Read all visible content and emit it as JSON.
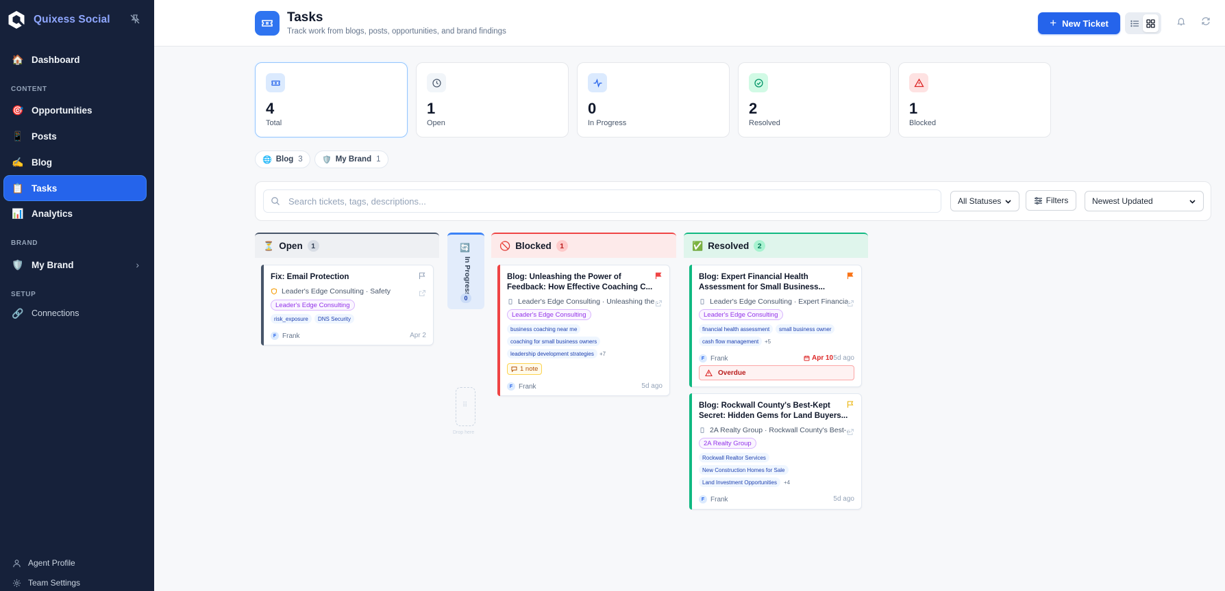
{
  "app": {
    "name": "Quixess Social"
  },
  "sidebar": {
    "dashboard": "Dashboard",
    "section_content": "CONTENT",
    "opportunities": "Opportunities",
    "posts": "Posts",
    "blog": "Blog",
    "tasks": "Tasks",
    "analytics": "Analytics",
    "section_brand": "BRAND",
    "my_brand": "My Brand",
    "section_setup": "SETUP",
    "connections": "Connections",
    "agent_profile": "Agent Profile",
    "team_settings": "Team Settings"
  },
  "header": {
    "title": "Tasks",
    "subtitle": "Track work from blogs, posts, opportunities, and brand findings",
    "new_ticket": "New Ticket"
  },
  "stats": [
    {
      "value": "4",
      "label": "Total"
    },
    {
      "value": "1",
      "label": "Open"
    },
    {
      "value": "0",
      "label": "In Progress"
    },
    {
      "value": "2",
      "label": "Resolved"
    },
    {
      "value": "1",
      "label": "Blocked"
    }
  ],
  "sources": [
    {
      "emoji": "🌐",
      "label": "Blog",
      "count": "3"
    },
    {
      "emoji": "🛡️",
      "label": "My Brand",
      "count": "1"
    }
  ],
  "toolbar": {
    "search_placeholder": "Search tickets, tags, descriptions...",
    "status_select": "All Statuses",
    "filters_label": "Filters",
    "sort_select": "Newest Updated"
  },
  "columns": {
    "open": {
      "emoji": "⏳",
      "label": "Open",
      "count": "1"
    },
    "in_progress": {
      "emoji": "🔄",
      "label": "In Progress",
      "count": "0"
    },
    "blocked": {
      "emoji": "🚫",
      "label": "Blocked",
      "count": "1"
    },
    "resolved": {
      "emoji": "✅",
      "label": "Resolved",
      "count": "2"
    }
  },
  "dropzone": {
    "label": "Drop here"
  },
  "cards": {
    "email": {
      "title": "Fix: Email Protection",
      "meta": "Leader's Edge Consulting · Safety",
      "org": "Leader's Edge Consulting",
      "tags": [
        "risk_exposure",
        "DNS Security"
      ],
      "assignee_initial": "F",
      "assignee": "Frank",
      "date": "Apr 2"
    },
    "feedback": {
      "title_line1": "Blog: Unleashing the Power of",
      "title_line2": "Feedback: How Effective Coaching C...",
      "meta": "Leader's Edge Consulting · Unleashing the ...",
      "org": "Leader's Edge Consulting",
      "tags": [
        "business coaching near me",
        "coaching for small business owners",
        "leadership development strategies"
      ],
      "more": "+7",
      "note": "1 note",
      "assignee_initial": "F",
      "assignee": "Frank",
      "date": "5d ago"
    },
    "financial": {
      "title_line1": "Blog: Expert Financial Health",
      "title_line2": "Assessment for Small Business...",
      "meta": "Leader's Edge Consulting · Expert Financia...",
      "org": "Leader's Edge Consulting",
      "tags": [
        "financial health assessment",
        "small business owner",
        "cash flow management"
      ],
      "more": "+5",
      "assignee_initial": "F",
      "assignee": "Frank",
      "due": "Apr 10",
      "date": "5d ago",
      "overdue": "Overdue"
    },
    "rockwall": {
      "title_line1": "Blog: Rockwall County's Best-Kept",
      "title_line2": "Secret: Hidden Gems for Land Buyers...",
      "meta": "2A Realty Group · Rockwall County's Best-...",
      "org": "2A Realty Group",
      "tags": [
        "Rockwall Realtor Services",
        "New Construction Homes for Sale",
        "Land Investment Opportunities"
      ],
      "more": "+4",
      "assignee_initial": "F",
      "assignee": "Frank",
      "date": "5d ago"
    }
  },
  "colors": {
    "sidebar_bg": "#16213a",
    "accent": "#2564eb",
    "open": "#475569",
    "blocked": "#ef4444",
    "resolved": "#10b981"
  }
}
